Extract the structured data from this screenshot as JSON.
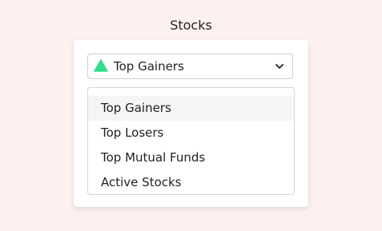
{
  "page": {
    "title": "Stocks"
  },
  "select": {
    "value": "Top Gainers",
    "icon": "trend-up-triangle-icon",
    "icon_color": "#2fe08a"
  },
  "options": [
    {
      "label": "Top Gainers",
      "selected": true
    },
    {
      "label": "Top Losers",
      "selected": false
    },
    {
      "label": "Top Mutual Funds",
      "selected": false
    },
    {
      "label": "Active Stocks",
      "selected": false
    }
  ],
  "colors": {
    "background": "#fdf1ef",
    "card": "#ffffff",
    "selected_row": "#f5f5f5"
  }
}
